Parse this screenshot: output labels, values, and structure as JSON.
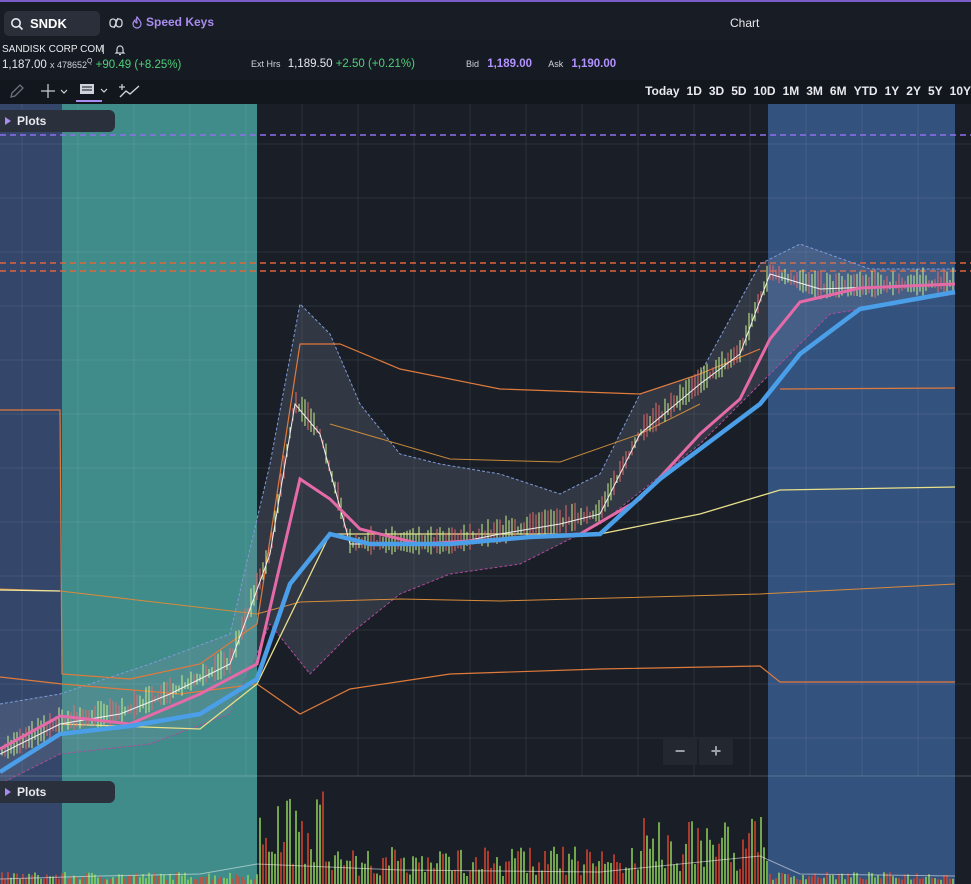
{
  "search": {
    "symbol": "SNDK"
  },
  "topbar": {
    "speed_keys_label": "Speed Keys",
    "title": "Chart"
  },
  "quote": {
    "name": "SANDISK CORP COM",
    "separator": "|",
    "last": "1,187.00",
    "volume": "x 478652",
    "volume_flag": "Q",
    "change": "+90.49 (+8.25%)",
    "ext_label": "Ext Hrs",
    "ext_price": "1,189.50",
    "ext_change": "+2.50 (+0.21%)",
    "bid_label": "Bid",
    "bid": "1,189.00",
    "ask_label": "Ask",
    "ask": "1,190.00"
  },
  "timeframes": [
    "Today",
    "1D",
    "3D",
    "5D",
    "10D",
    "1M",
    "3M",
    "6M",
    "YTD",
    "1Y",
    "2Y",
    "5Y",
    "10Y"
  ],
  "plots": {
    "upper_label": "Plots",
    "lower_label": "Plots"
  },
  "zoom": {
    "minus": "−",
    "plus": "+"
  },
  "colors": {
    "session_left": "#34476a",
    "session_teal": "#3f8c8a",
    "session_right": "#34527e",
    "pink_ma": "#e56aa8",
    "blue_ma": "#4a9fe8",
    "accent_purple": "#a88cf0",
    "dashed_orange": "#e0643c"
  }
}
